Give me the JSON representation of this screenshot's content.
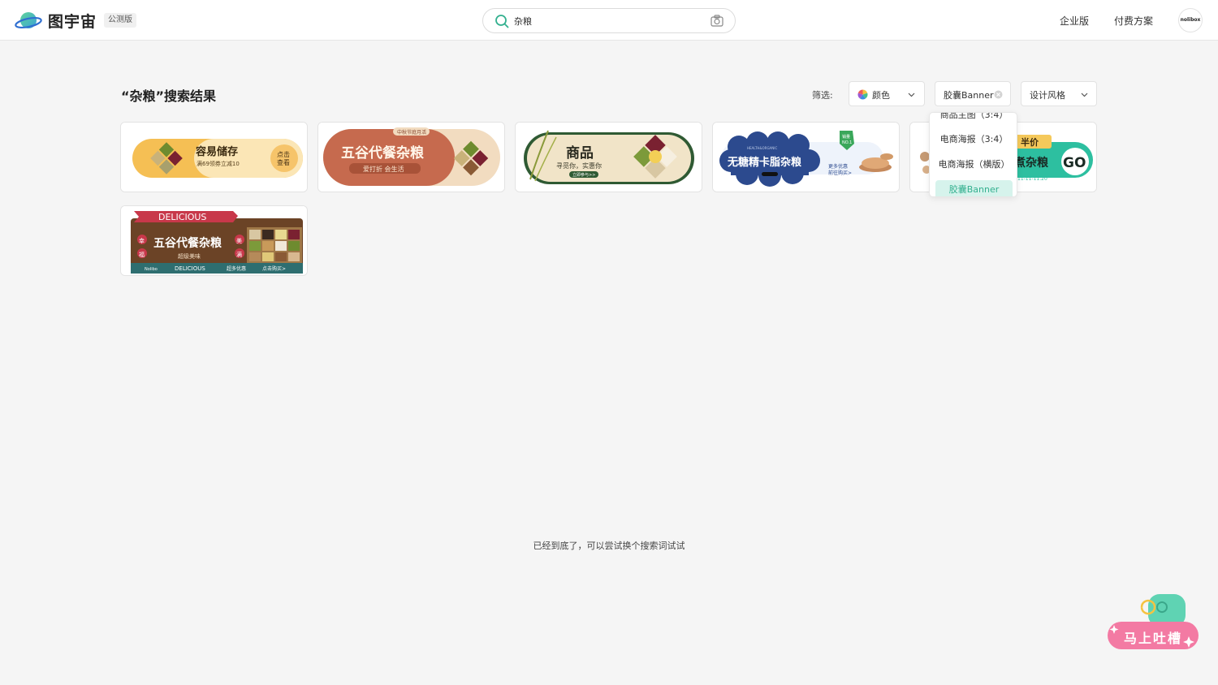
{
  "header": {
    "logo_text": "图宇宙",
    "beta_badge": "公测版",
    "search_value": "杂粮",
    "nav": [
      "企业版",
      "付费方案"
    ],
    "avatar_text": "nolibox"
  },
  "results": {
    "title": "“杂粮”搜索结果",
    "filter_label": "筛选:",
    "filters": {
      "color": "颜色",
      "type": "胶囊Banner",
      "style": "设计风格"
    }
  },
  "dropdown": {
    "items": [
      "商品主图（3:4）",
      "电商海报（3:4）",
      "电商海报（横版）",
      "胶囊Banner"
    ],
    "selected_index": 3
  },
  "cards": [
    {
      "title": "容易储存",
      "subtitle": "满69领券立减10",
      "cta": "点击",
      "cta2": "查看"
    },
    {
      "title": "五谷代餐杂粮",
      "subtitle": "爱打折 会生活",
      "tag": "中秋节庭月活"
    },
    {
      "title": "商品",
      "subtitle": "寻觅你，实惠你",
      "tag": "立即参与>>"
    },
    {
      "title": "无糖精卡脂杂粮",
      "subtitle": "HEALTH&ORGANIC",
      "extra": "更多优惠",
      "extra2": "前往购买>",
      "badge": "销量",
      "badge2": "NO.1"
    },
    {
      "title": "煮杂粮",
      "tag": "半价",
      "date": "11-11-11.20",
      "cta": "GO"
    },
    {
      "title": "五谷代餐杂粮",
      "ribbon": "DELICIOUS",
      "subtitle": "超级美味",
      "left1": "幸",
      "left2": "福",
      "right1": "美",
      "right2": "满",
      "footer1": "DELICIOUS",
      "footer2": "超多优惠",
      "footer3": "点击购买>",
      "brand": "Nolibo"
    }
  ],
  "bottom_message": "已经到底了，可以尝试换个搜索词试试",
  "feedback": {
    "label": "马上吐槽"
  },
  "colors": {
    "accent": "#33b08f",
    "accent_light": "#d6f3ec",
    "feedback_pink": "#f06a9a"
  }
}
